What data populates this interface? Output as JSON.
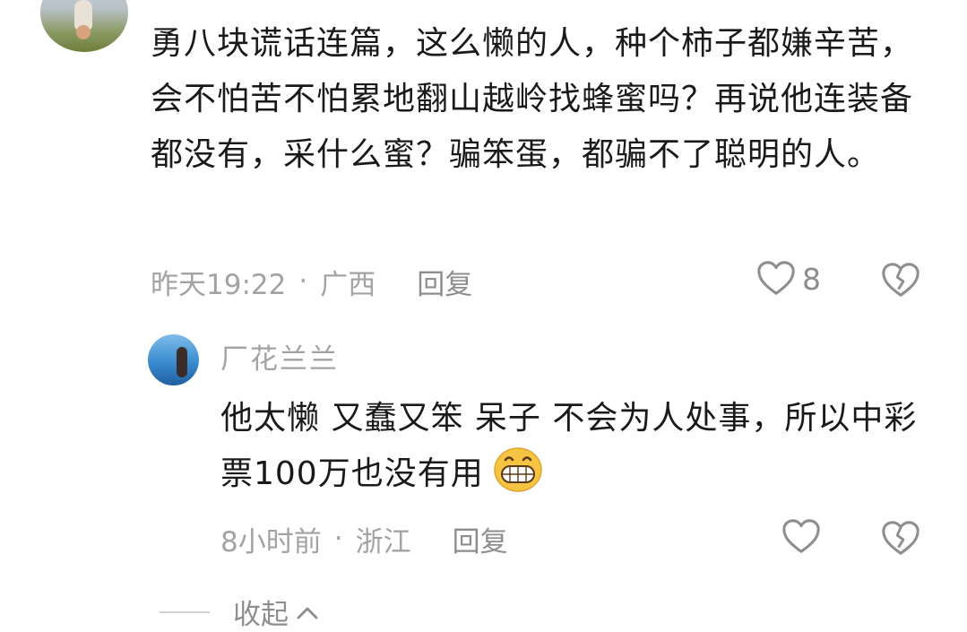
{
  "comment": {
    "text": "勇八块谎话连篇，这么懒的人，种个柿子都嫌辛苦，会不怕苦不怕累地翻山越岭找蜂蜜吗？再说他连装备都没有，采什么蜜？骗笨蛋，都骗不了聪明的人。",
    "time": "昨天19:22",
    "separator": "·",
    "location": "广西",
    "reply_label": "回复",
    "like_count": "8",
    "like_icon": "heart-outline-icon",
    "dislike_icon": "broken-heart-icon"
  },
  "reply": {
    "username": "厂花兰兰",
    "text": "他太懒 又蠢又笨 呆子 不会为人处事，所以中彩票100万也没有用",
    "emoji": "grinning-face-emoji",
    "time": "8小时前",
    "separator": "·",
    "location": "浙江",
    "reply_label": "回复",
    "like_icon": "heart-outline-icon",
    "dislike_icon": "broken-heart-icon"
  },
  "collapse": {
    "label": "收起",
    "icon": "chevron-up-icon"
  },
  "colors": {
    "text_primary": "#1a1a1a",
    "text_secondary": "#a3a3a3",
    "icon": "#8e8e8e"
  }
}
